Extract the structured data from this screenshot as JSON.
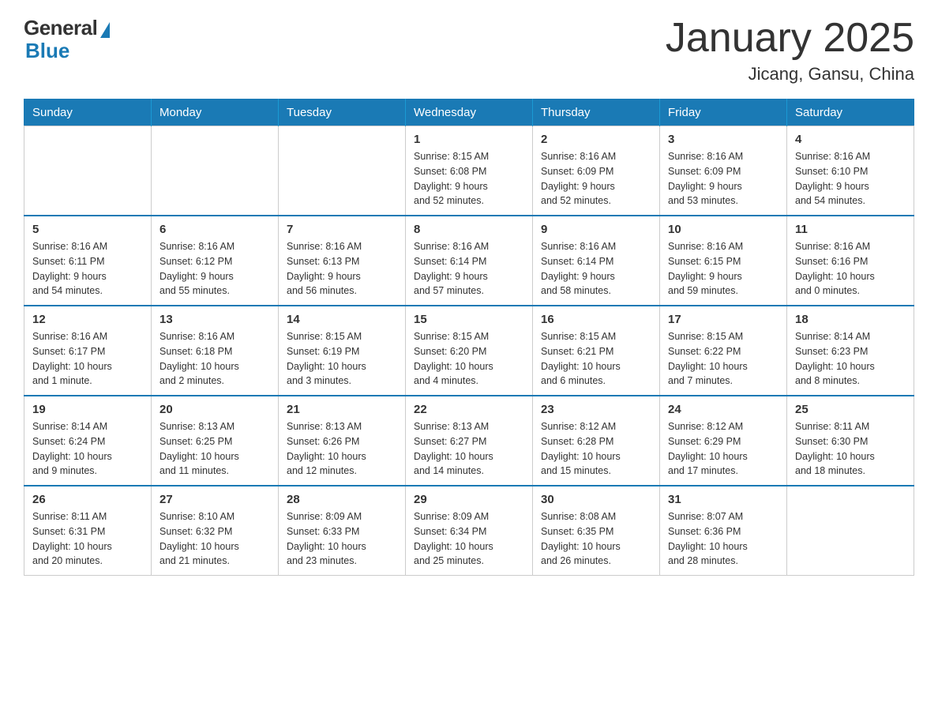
{
  "header": {
    "logo_general": "General",
    "logo_blue": "Blue",
    "title": "January 2025",
    "location": "Jicang, Gansu, China"
  },
  "weekdays": [
    "Sunday",
    "Monday",
    "Tuesday",
    "Wednesday",
    "Thursday",
    "Friday",
    "Saturday"
  ],
  "weeks": [
    [
      {
        "day": "",
        "info": ""
      },
      {
        "day": "",
        "info": ""
      },
      {
        "day": "",
        "info": ""
      },
      {
        "day": "1",
        "info": "Sunrise: 8:15 AM\nSunset: 6:08 PM\nDaylight: 9 hours\nand 52 minutes."
      },
      {
        "day": "2",
        "info": "Sunrise: 8:16 AM\nSunset: 6:09 PM\nDaylight: 9 hours\nand 52 minutes."
      },
      {
        "day": "3",
        "info": "Sunrise: 8:16 AM\nSunset: 6:09 PM\nDaylight: 9 hours\nand 53 minutes."
      },
      {
        "day": "4",
        "info": "Sunrise: 8:16 AM\nSunset: 6:10 PM\nDaylight: 9 hours\nand 54 minutes."
      }
    ],
    [
      {
        "day": "5",
        "info": "Sunrise: 8:16 AM\nSunset: 6:11 PM\nDaylight: 9 hours\nand 54 minutes."
      },
      {
        "day": "6",
        "info": "Sunrise: 8:16 AM\nSunset: 6:12 PM\nDaylight: 9 hours\nand 55 minutes."
      },
      {
        "day": "7",
        "info": "Sunrise: 8:16 AM\nSunset: 6:13 PM\nDaylight: 9 hours\nand 56 minutes."
      },
      {
        "day": "8",
        "info": "Sunrise: 8:16 AM\nSunset: 6:14 PM\nDaylight: 9 hours\nand 57 minutes."
      },
      {
        "day": "9",
        "info": "Sunrise: 8:16 AM\nSunset: 6:14 PM\nDaylight: 9 hours\nand 58 minutes."
      },
      {
        "day": "10",
        "info": "Sunrise: 8:16 AM\nSunset: 6:15 PM\nDaylight: 9 hours\nand 59 minutes."
      },
      {
        "day": "11",
        "info": "Sunrise: 8:16 AM\nSunset: 6:16 PM\nDaylight: 10 hours\nand 0 minutes."
      }
    ],
    [
      {
        "day": "12",
        "info": "Sunrise: 8:16 AM\nSunset: 6:17 PM\nDaylight: 10 hours\nand 1 minute."
      },
      {
        "day": "13",
        "info": "Sunrise: 8:16 AM\nSunset: 6:18 PM\nDaylight: 10 hours\nand 2 minutes."
      },
      {
        "day": "14",
        "info": "Sunrise: 8:15 AM\nSunset: 6:19 PM\nDaylight: 10 hours\nand 3 minutes."
      },
      {
        "day": "15",
        "info": "Sunrise: 8:15 AM\nSunset: 6:20 PM\nDaylight: 10 hours\nand 4 minutes."
      },
      {
        "day": "16",
        "info": "Sunrise: 8:15 AM\nSunset: 6:21 PM\nDaylight: 10 hours\nand 6 minutes."
      },
      {
        "day": "17",
        "info": "Sunrise: 8:15 AM\nSunset: 6:22 PM\nDaylight: 10 hours\nand 7 minutes."
      },
      {
        "day": "18",
        "info": "Sunrise: 8:14 AM\nSunset: 6:23 PM\nDaylight: 10 hours\nand 8 minutes."
      }
    ],
    [
      {
        "day": "19",
        "info": "Sunrise: 8:14 AM\nSunset: 6:24 PM\nDaylight: 10 hours\nand 9 minutes."
      },
      {
        "day": "20",
        "info": "Sunrise: 8:13 AM\nSunset: 6:25 PM\nDaylight: 10 hours\nand 11 minutes."
      },
      {
        "day": "21",
        "info": "Sunrise: 8:13 AM\nSunset: 6:26 PM\nDaylight: 10 hours\nand 12 minutes."
      },
      {
        "day": "22",
        "info": "Sunrise: 8:13 AM\nSunset: 6:27 PM\nDaylight: 10 hours\nand 14 minutes."
      },
      {
        "day": "23",
        "info": "Sunrise: 8:12 AM\nSunset: 6:28 PM\nDaylight: 10 hours\nand 15 minutes."
      },
      {
        "day": "24",
        "info": "Sunrise: 8:12 AM\nSunset: 6:29 PM\nDaylight: 10 hours\nand 17 minutes."
      },
      {
        "day": "25",
        "info": "Sunrise: 8:11 AM\nSunset: 6:30 PM\nDaylight: 10 hours\nand 18 minutes."
      }
    ],
    [
      {
        "day": "26",
        "info": "Sunrise: 8:11 AM\nSunset: 6:31 PM\nDaylight: 10 hours\nand 20 minutes."
      },
      {
        "day": "27",
        "info": "Sunrise: 8:10 AM\nSunset: 6:32 PM\nDaylight: 10 hours\nand 21 minutes."
      },
      {
        "day": "28",
        "info": "Sunrise: 8:09 AM\nSunset: 6:33 PM\nDaylight: 10 hours\nand 23 minutes."
      },
      {
        "day": "29",
        "info": "Sunrise: 8:09 AM\nSunset: 6:34 PM\nDaylight: 10 hours\nand 25 minutes."
      },
      {
        "day": "30",
        "info": "Sunrise: 8:08 AM\nSunset: 6:35 PM\nDaylight: 10 hours\nand 26 minutes."
      },
      {
        "day": "31",
        "info": "Sunrise: 8:07 AM\nSunset: 6:36 PM\nDaylight: 10 hours\nand 28 minutes."
      },
      {
        "day": "",
        "info": ""
      }
    ]
  ]
}
